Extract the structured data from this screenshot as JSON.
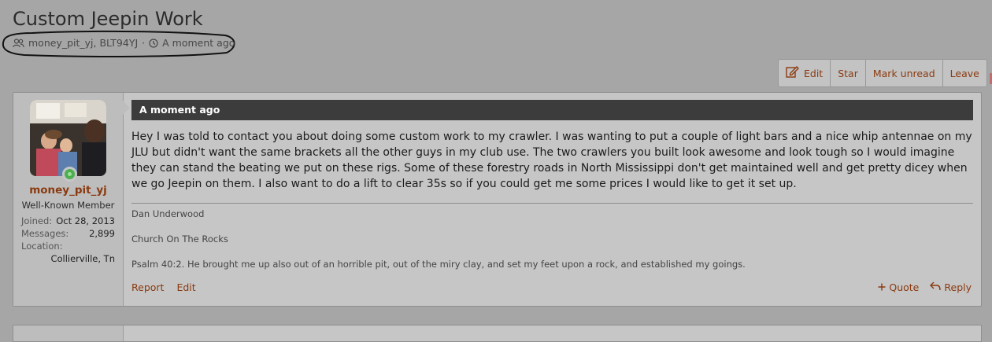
{
  "thread": {
    "title": "Custom Jeepin Work",
    "participants": "money_pit_yj, BLT94YJ",
    "separator": "·",
    "time": "A moment ago"
  },
  "toolbar": {
    "edit": "Edit",
    "star": "Star",
    "mark_unread": "Mark unread",
    "leave": "Leave"
  },
  "post": {
    "header_time": "A moment ago",
    "body": "Hey I was told to contact you about doing some custom work to my crawler. I was wanting to put a couple of light bars and a nice whip antennae on my JLU but didn't want the same brackets all the other guys in my club use. The two crawlers you built look awesome and look tough so I would imagine they can stand the beating we put on these rigs. Some of these forestry roads in North Mississippi don't get maintained well and get pretty dicey when we go Jeepin on them. I also want to do a lift to clear 35s so if you could get me some prices I would like to get it set up.",
    "signature": [
      "Dan Underwood",
      "Church On The Rocks",
      "Psalm 40:2. He brought me up also out of an horrible pit, out of the miry clay, and set my feet upon a rock, and established my goings."
    ],
    "actions": {
      "report": "Report",
      "edit": "Edit",
      "quote": "Quote",
      "reply": "Reply"
    }
  },
  "user": {
    "name": "money_pit_yj",
    "title": "Well-Known Member",
    "joined_label": "Joined:",
    "joined_value": "Oct 28, 2013",
    "messages_label": "Messages:",
    "messages_value": "2,899",
    "location_label": "Location:",
    "location_value": "Collierville, Tn",
    "status": "online"
  },
  "colors": {
    "link": "#8a3a10",
    "header_bar": "#3c3c3c",
    "online": "#4caf50",
    "page_bg": "#a6a6a6"
  },
  "icons": [
    "users-icon",
    "clock-icon",
    "edit-icon",
    "plus-icon",
    "reply-icon"
  ]
}
